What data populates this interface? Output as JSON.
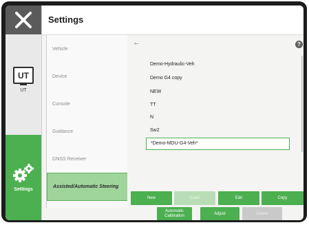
{
  "header": {
    "title": "Settings"
  },
  "leftbar": {
    "ut_icon_text": "UT",
    "ut_label": "UT",
    "settings_label": "Settings"
  },
  "menu": {
    "items": [
      {
        "label": "Vehicle"
      },
      {
        "label": "Device"
      },
      {
        "label": "Console"
      },
      {
        "label": "Guidance"
      },
      {
        "label": "GNSS Receiver"
      },
      {
        "label": "Assisted/Automatic Steering",
        "active": true
      }
    ]
  },
  "content": {
    "back_arrow": "←",
    "help": "?",
    "vehicles": [
      "Demo-Hydraulic-Veh",
      "Demo G4 copy",
      "NEW",
      "TT",
      "N",
      "Sw2",
      "*Demo-MDU-G4-Veh*"
    ],
    "selected_index": 6
  },
  "buttons": {
    "new": "New",
    "load": "Load",
    "edit": "Edit",
    "copy": "Copy",
    "automatic_calibration": "Automatic Calibration",
    "adjust": "Adjust",
    "delete": "Delete"
  },
  "colors": {
    "accent": "#4caf50",
    "active_menu": "#9fd49b",
    "device_frame": "#1c1c1c"
  }
}
